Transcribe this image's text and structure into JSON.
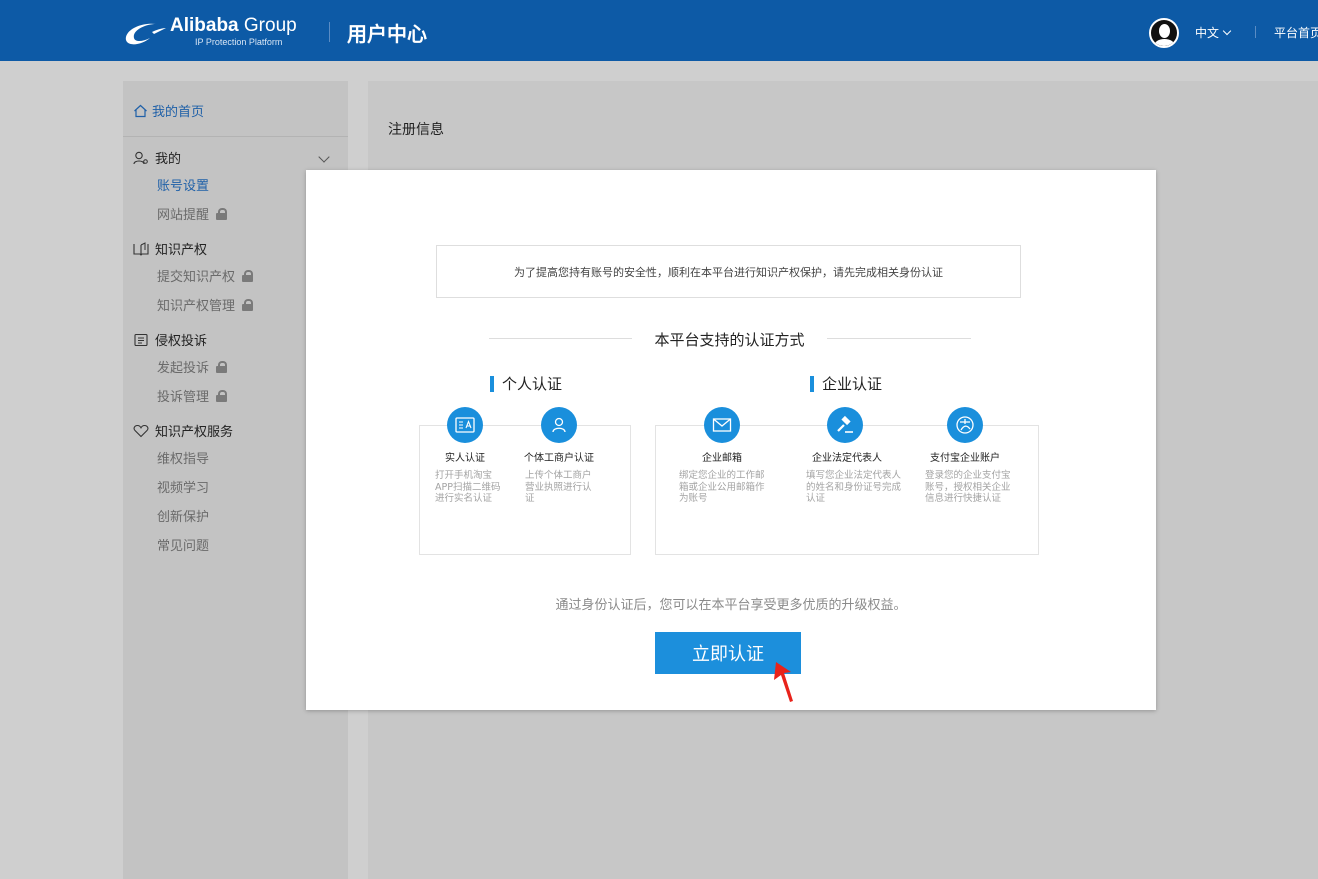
{
  "header": {
    "logo_name": "Alibaba",
    "logo_name_suffix": "Group",
    "logo_sub": "IP Protection Platform",
    "title": "用户中心",
    "language": "中文",
    "home_link": "平台首页"
  },
  "sidebar": {
    "home": "我的首页",
    "groups": [
      {
        "label": "我的",
        "icon": "user-icon",
        "items": [
          {
            "label": "账号设置",
            "active": true,
            "locked": false
          },
          {
            "label": "网站提醒",
            "active": false,
            "locked": true
          }
        ]
      },
      {
        "label": "知识产权",
        "icon": "book-icon",
        "items": [
          {
            "label": "提交知识产权",
            "locked": true
          },
          {
            "label": "知识产权管理",
            "locked": true
          }
        ]
      },
      {
        "label": "侵权投诉",
        "icon": "complaint-icon",
        "items": [
          {
            "label": "发起投诉",
            "locked": true
          },
          {
            "label": "投诉管理",
            "locked": true
          }
        ]
      },
      {
        "label": "知识产权服务",
        "icon": "heart-icon",
        "items": [
          {
            "label": "维权指导"
          },
          {
            "label": "视频学习"
          },
          {
            "label": "创新保护"
          },
          {
            "label": "常见问题"
          }
        ]
      }
    ]
  },
  "main": {
    "title": "注册信息"
  },
  "modal": {
    "notice": "为了提高您持有账号的安全性，顺利在本平台进行知识产权保护，请先完成相关身份认证",
    "methods_title": "本平台支持的认证方式",
    "personal": {
      "title": "个人认证",
      "items": [
        {
          "title": "实人认证",
          "desc": "打开手机淘宝APP扫描二维码进行实名认证",
          "icon": "id-card-icon"
        },
        {
          "title": "个体工商户认证",
          "desc": "上传个体工商户营业执照进行认证",
          "icon": "person-icon"
        }
      ]
    },
    "enterprise": {
      "title": "企业认证",
      "items": [
        {
          "title": "企业邮箱",
          "desc": "绑定您企业的工作邮箱或企业公用邮箱作为账号",
          "icon": "mail-icon"
        },
        {
          "title": "企业法定代表人",
          "desc": "填写您企业法定代表人的姓名和身份证号完成认证",
          "icon": "gavel-icon"
        },
        {
          "title": "支付宝企业账户",
          "desc": "登录您的企业支付宝账号，授权相关企业信息进行快捷认证",
          "icon": "alipay-icon"
        }
      ]
    },
    "footer_text": "通过身份认证后，您可以在本平台享受更多优质的升级权益。",
    "cta": "立即认证"
  },
  "colors": {
    "header_bg": "#0d5aa6",
    "accent": "#1a8fdc",
    "link": "#1f60a8"
  }
}
